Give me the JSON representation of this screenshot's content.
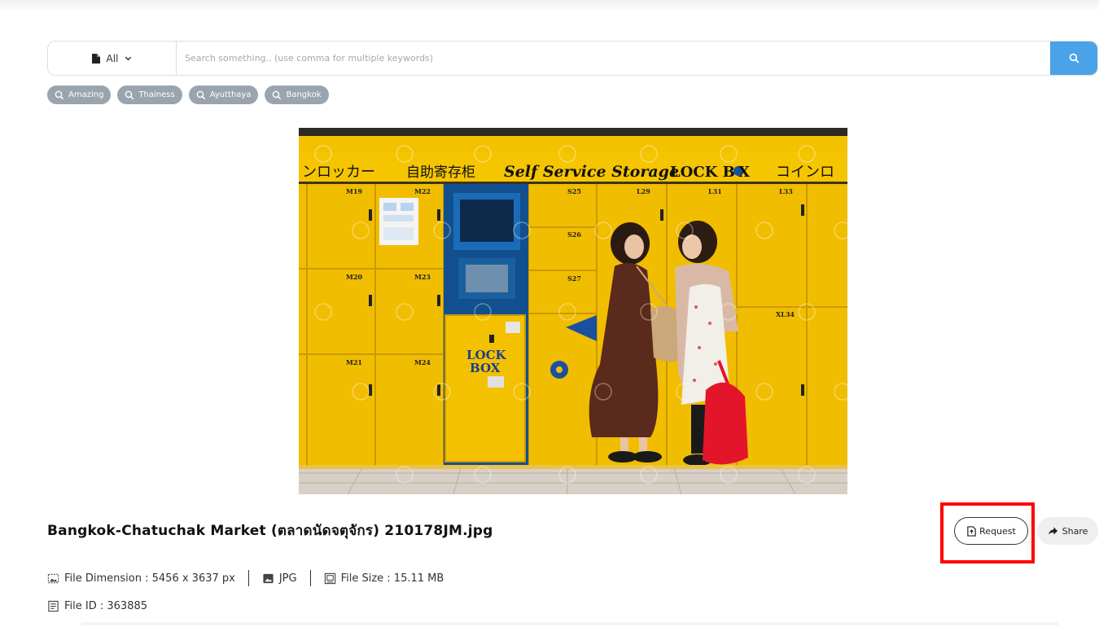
{
  "search": {
    "type_label": "All",
    "placeholder": "Search something.. (use comma for multiple keywords)",
    "value": ""
  },
  "tags": [
    "Amazing",
    "Thainess",
    "Ayutthaya",
    "Bangkok"
  ],
  "photo": {
    "sign_jp_left": "ンロッカー",
    "sign_jp_mid": "自助寄存柜",
    "sign_en": "Self Service Storage",
    "sign_brand": "LOCK B",
    "sign_brand_suffix": "X",
    "sign_jp_right": "コインロ",
    "kiosk_logo_1": "LOCK",
    "kiosk_logo_2": "BOX",
    "locker_labels": [
      "M19",
      "M22",
      "S25",
      "L29",
      "L31",
      "L33",
      "S26",
      "M20",
      "M23",
      "S27",
      "XL34",
      "M21",
      "M24"
    ]
  },
  "file": {
    "title": "Bangkok-Chatuchak Market (ตลาดนัดจตุจักร) 210178JM.jpg",
    "dimension": "File Dimension :  5456 x 3637 px",
    "format": "JPG",
    "size": "File Size :  15.11 MB",
    "id": "File ID :  363885"
  },
  "actions": {
    "request_label": "Request",
    "share_label": "Share"
  },
  "colors": {
    "accent": "#4aa3e8",
    "tag_bg": "#9aa4ae",
    "highlight": "#ff0000",
    "locker_yellow": "#f3c000"
  },
  "icons": [
    "file-icon",
    "chevron-down-icon",
    "search-icon",
    "request-file-icon",
    "share-arrow-icon",
    "dimension-icon",
    "image-icon",
    "file-size-icon",
    "file-id-icon"
  ]
}
